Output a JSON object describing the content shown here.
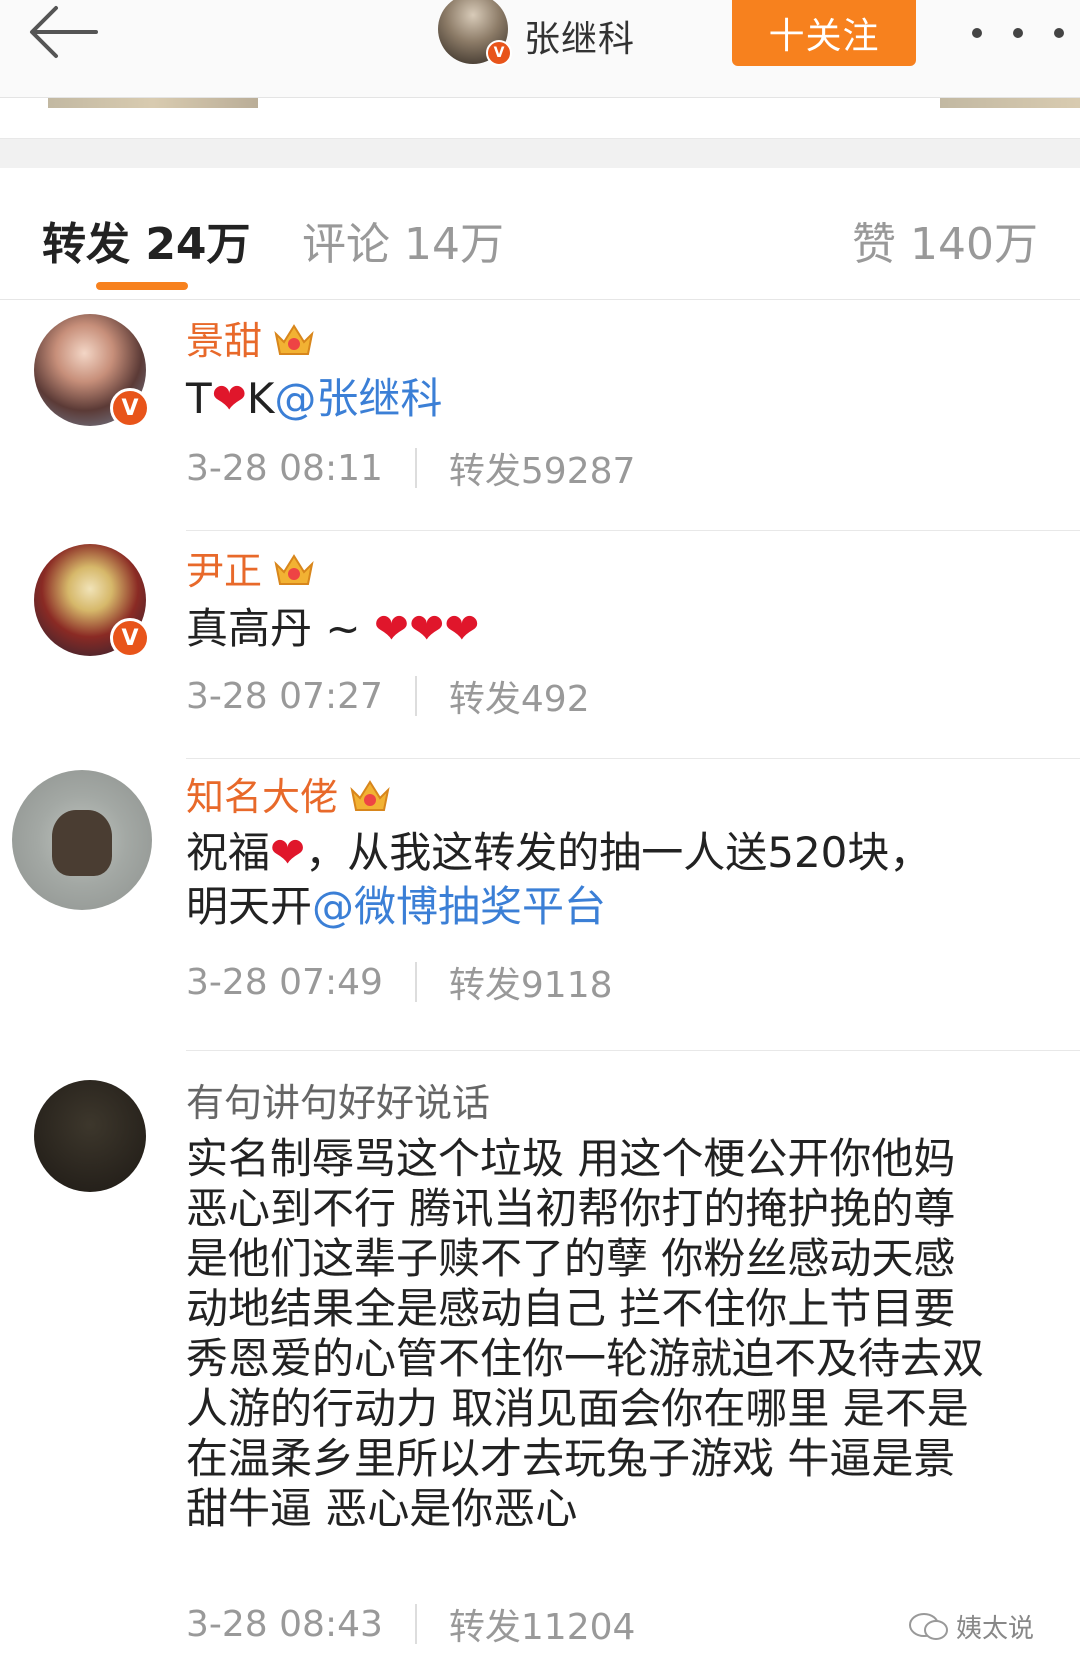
{
  "topbar": {
    "name": "张继科",
    "follow_label": "十关注",
    "verified_badge": "V"
  },
  "tabs": {
    "repost": "转发 24万",
    "comment": "评论 14万",
    "like": "赞 140万"
  },
  "items": [
    {
      "name": "景甜",
      "badge": "V",
      "text_prefix": "T",
      "text_heart": "❤",
      "text_mid": "K",
      "mention": "@张继科",
      "time": "3-28 08:11",
      "reposts": "转发59287"
    },
    {
      "name": "尹正",
      "badge": "V",
      "text": "真高丹 ~ ",
      "hearts": "❤❤❤",
      "time": "3-28 07:27",
      "reposts": "转发492"
    },
    {
      "name": "知名大佬",
      "text_a": "祝福",
      "text_heart": "❤",
      "text_b": "，从我这转发的抽一人送520块，",
      "text_c": "明天开",
      "mention": "@微博抽奖平台",
      "time": "3-28 07:49",
      "reposts": "转发9118"
    },
    {
      "name": "有句讲句好好说话",
      "lines": [
        "实名制辱骂这个垃圾 用这个梗公开你他妈",
        "恶心到不行 腾讯当初帮你打的掩护挽的尊",
        "是他们这辈子赎不了的孽 你粉丝感动天感",
        "动地结果全是感动自己 拦不住你上节目要",
        "秀恩爱的心管不住你一轮游就迫不及待去双",
        "人游的行动力 取消见面会你在哪里 是不是",
        "在温柔乡里所以才去玩兔子游戏 牛逼是景",
        "甜牛逼 恶心是你恶心"
      ],
      "time": "3-28 08:43",
      "reposts": "转发11204"
    }
  ],
  "watermark": "姨太说",
  "colors": {
    "accent": "#f7811e",
    "username": "#e8692a",
    "mention": "#3b7fd6",
    "heart": "#e0162b"
  }
}
